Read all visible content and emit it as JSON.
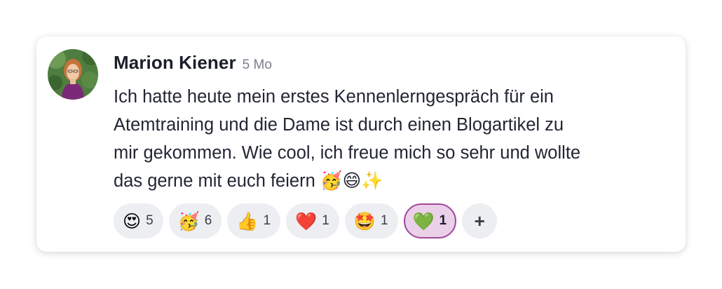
{
  "post": {
    "author": "Marion Kiener",
    "time": "5 Mo",
    "lines": [
      "Ich hatte heute mein erstes Kennenlerngespräch für ein",
      "Atemtraining und die Dame ist durch einen Blogartikel zu",
      "mir gekommen. Wie cool, ich freue mich so sehr und wollte",
      "das gerne mit euch feiern 🥳😄✨"
    ]
  },
  "reactions": [
    {
      "emoji": "😍",
      "count": "5",
      "icon": "heart-eyes-icon",
      "active": false
    },
    {
      "emoji": "🥳",
      "count": "6",
      "icon": "party-face-icon",
      "active": false
    },
    {
      "emoji": "👍",
      "count": "1",
      "icon": "thumbs-up-icon",
      "active": false
    },
    {
      "emoji": "❤️",
      "count": "1",
      "icon": "red-heart-icon",
      "active": false
    },
    {
      "emoji": "🤩",
      "count": "1",
      "icon": "star-struck-icon",
      "active": false
    },
    {
      "emoji": "💚",
      "count": "1",
      "icon": "green-heart-icon",
      "active": true
    }
  ],
  "add_reaction": {
    "label": "+",
    "icon": "plus-icon"
  },
  "colors": {
    "active_bg": "#ead0e8",
    "active_border": "#a2479b",
    "pill_bg": "#eceef1"
  }
}
